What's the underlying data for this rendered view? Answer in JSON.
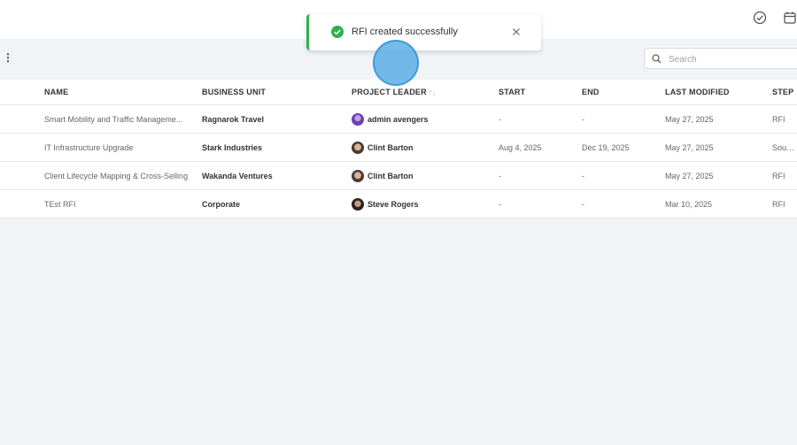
{
  "toast": {
    "message": "RFI created successfully",
    "accent_color": "#2bb24c"
  },
  "topbar": {
    "icons": [
      "check-circle-icon",
      "calendar-icon"
    ]
  },
  "toolbar": {
    "search_placeholder": "Search",
    "more_icon": "⋮"
  },
  "table": {
    "headers": [
      "NAME",
      "BUSINESS UNIT",
      "PROJECT LEADER",
      "START",
      "END",
      "LAST MODIFIED",
      "STEP"
    ],
    "sort_icon": "↑↓",
    "rows": [
      {
        "name": "Smart Mobility and Traffic Manageme...",
        "business_unit": "Ragnarok Travel",
        "leader": "admin avengers",
        "start": "-",
        "end": "-",
        "last_modified": "May 27, 2025",
        "step": "RFI"
      },
      {
        "name": "IT Infrastructure Upgrade",
        "business_unit": "Stark Industries",
        "leader": "Clint Barton",
        "start": "Aug 4, 2025",
        "end": "Dec 19, 2025",
        "last_modified": "May 27, 2025",
        "step": "Sourcin"
      },
      {
        "name": "Client Lifecycle Mapping & Cross-Selling",
        "business_unit": "Wakanda Ventures",
        "leader": "Clint Barton",
        "start": "-",
        "end": "-",
        "last_modified": "May 27, 2025",
        "step": "RFI"
      },
      {
        "name": "TEst RFI",
        "business_unit": "Corporate",
        "leader": "Steve Rogers",
        "start": "-",
        "end": "-",
        "last_modified": "Mar 10, 2025",
        "step": "RFI"
      }
    ]
  }
}
